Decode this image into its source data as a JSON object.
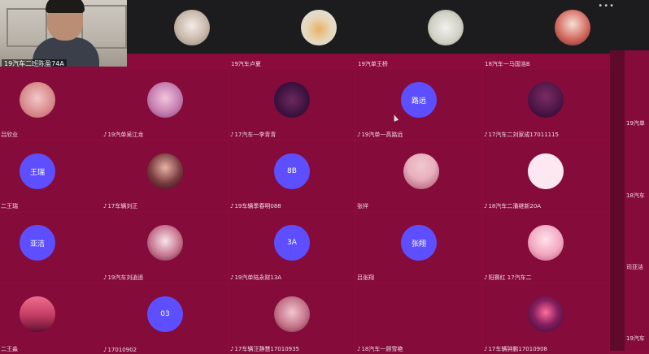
{
  "speaker": {
    "label": "19汽车二班陈盈74A"
  },
  "top_row_labels": [
    "19汽车卢夏",
    "19汽单王桥",
    "18汽车一马国浩B"
  ],
  "tiles": [
    {
      "label": "吕欣业",
      "avatar_text": ""
    },
    {
      "label": "19汽单吴江龙",
      "avatar_text": ""
    },
    {
      "label": "17汽车一李青青",
      "avatar_text": ""
    },
    {
      "label": "19汽单一高路远",
      "avatar_text": "路远"
    },
    {
      "label": "17汽车二刘家成17011115",
      "avatar_text": ""
    },
    {
      "label": "二王瑞",
      "avatar_text": "王瑞"
    },
    {
      "label": "17车辆刘正",
      "avatar_text": ""
    },
    {
      "label": "19车辆季春明088",
      "avatar_text": "8B"
    },
    {
      "label": "张祥",
      "avatar_text": ""
    },
    {
      "label": "18汽车二潘继新20A",
      "avatar_text": ""
    },
    {
      "label": "",
      "avatar_text": "亚洁"
    },
    {
      "label": "19汽车刘逍遥",
      "avatar_text": ""
    },
    {
      "label": "19汽单陆永财13A",
      "avatar_text": "3A"
    },
    {
      "label": "吕张翔",
      "avatar_text": "张翔"
    },
    {
      "label": "阳赛红 17汽车二",
      "avatar_text": ""
    },
    {
      "label": "二王淼",
      "avatar_text": ""
    },
    {
      "label": "17010902",
      "avatar_text": "03"
    },
    {
      "label": "17车辆汪静慧17010935",
      "avatar_text": ""
    },
    {
      "label": "18汽车一顾雪艳",
      "avatar_text": ""
    },
    {
      "label": "17车辆钟鹏17010908",
      "avatar_text": ""
    }
  ],
  "right_labels": [
    "19汽单",
    "18汽车",
    "司亚洁",
    "19汽车"
  ],
  "colors": {
    "background": "#8a0b3c",
    "avatar_blue": "#5d4fff"
  }
}
